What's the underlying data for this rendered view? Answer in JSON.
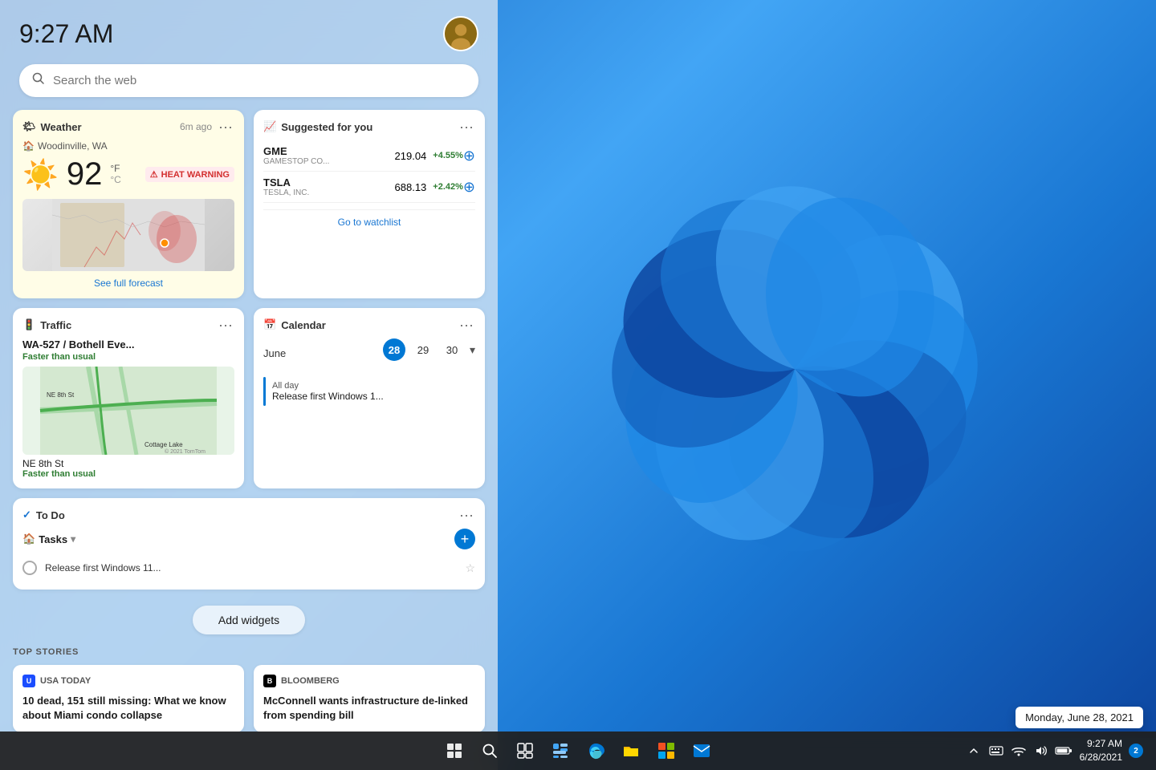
{
  "desktop": {
    "bg_color_start": "#1565c0",
    "bg_color_end": "#0d47a1"
  },
  "header": {
    "time": "9:27 AM"
  },
  "search": {
    "placeholder": "Search the web"
  },
  "widgets": {
    "weather": {
      "title": "Weather",
      "updated": "6m ago",
      "location": "Woodinville, WA",
      "temperature": "92",
      "unit_f": "°F",
      "unit_c": "°C",
      "warning": "HEAT WARNING",
      "forecast_link": "See full forecast"
    },
    "stocks": {
      "title": "Suggested for you",
      "items": [
        {
          "ticker": "GME",
          "name": "GAMESTOP CO...",
          "price": "219.04",
          "change": "+4.55%",
          "positive": true
        },
        {
          "ticker": "TSLA",
          "name": "TESLA, INC.",
          "price": "688.13",
          "change": "+2.42%",
          "positive": true
        }
      ],
      "watchlist_link": "Go to watchlist"
    },
    "traffic": {
      "title": "Traffic",
      "route1": "WA-527 / Bothell Eve...",
      "status1": "Faster than usual",
      "route2": "NE 8th St",
      "status2": "Faster than usual",
      "location": "Cottage Lake",
      "map_credit": "© 2021 TomTom"
    },
    "calendar": {
      "title": "Calendar",
      "month": "June",
      "dates": [
        {
          "day": "28",
          "today": true
        },
        {
          "day": "29",
          "today": false
        },
        {
          "day": "30",
          "today": false
        }
      ],
      "event_time": "All day",
      "event_title": "Release first Windows 1..."
    },
    "todo": {
      "title": "To Do",
      "tasks_label": "Tasks",
      "task_text": "Release first Windows 11..."
    }
  },
  "add_widgets": {
    "label": "Add widgets"
  },
  "top_stories": {
    "label": "TOP STORIES",
    "stories": [
      {
        "source": "USA TODAY",
        "source_type": "usatoday",
        "headline": "10 dead, 151 still missing: What we know about Miami condo collapse"
      },
      {
        "source": "Bloomberg",
        "source_type": "bloomberg",
        "headline": "McConnell wants infrastructure de-linked from spending bill"
      }
    ]
  },
  "taskbar": {
    "clock_time": "9:27 AM",
    "clock_date": "6/28/2021",
    "date_tooltip": "Monday, June 28, 2021",
    "notification_count": "2"
  }
}
